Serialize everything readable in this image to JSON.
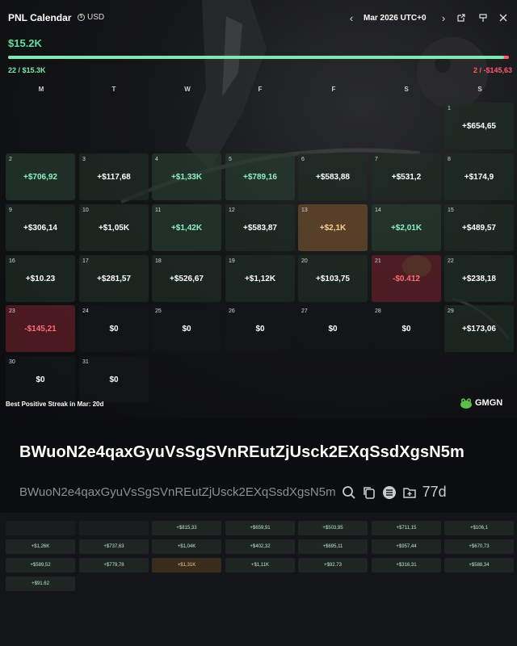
{
  "header": {
    "title": "PNL Calendar",
    "currency": "USD",
    "month": "Mar 2026 UTC+0"
  },
  "summary": {
    "total": "$15.2K",
    "wins": "22 / $15.3K",
    "losses_count": "2 /",
    "losses_amount": "-$145,63",
    "win_fraction": 0.99
  },
  "weekdays": [
    "M",
    "T",
    "W",
    "F",
    "F",
    "S",
    "S"
  ],
  "weekday_labels": {
    "m": "M",
    "t": "T",
    "w": "W",
    "th": "F",
    "f": "F",
    "s": "S",
    "su": "S"
  },
  "days": [
    {
      "d": "1",
      "v": "+$654,65"
    },
    {
      "d": "2",
      "v": "+$706,92"
    },
    {
      "d": "3",
      "v": "+$117,68"
    },
    {
      "d": "4",
      "v": "+$1,33K"
    },
    {
      "d": "5",
      "v": "+$789,16"
    },
    {
      "d": "6",
      "v": "+$583,88"
    },
    {
      "d": "7",
      "v": "+$531,2"
    },
    {
      "d": "8",
      "v": "+$174,9"
    },
    {
      "d": "9",
      "v": "+$306,14"
    },
    {
      "d": "10",
      "v": "+$1,05K"
    },
    {
      "d": "11",
      "v": "+$1,42K"
    },
    {
      "d": "12",
      "v": "+$583,87"
    },
    {
      "d": "13",
      "v": "+$2,1K"
    },
    {
      "d": "14",
      "v": "+$2,01K"
    },
    {
      "d": "15",
      "v": "+$489,57"
    },
    {
      "d": "16",
      "v": "+$10.23"
    },
    {
      "d": "17",
      "v": "+$281,57"
    },
    {
      "d": "18",
      "v": "+$526,67"
    },
    {
      "d": "19",
      "v": "+$1,12K"
    },
    {
      "d": "20",
      "v": "+$103,75"
    },
    {
      "d": "21",
      "v": "-$0.412"
    },
    {
      "d": "22",
      "v": "+$238,18"
    },
    {
      "d": "23",
      "v": "-$145,21"
    },
    {
      "d": "24",
      "v": "$0"
    },
    {
      "d": "25",
      "v": "$0"
    },
    {
      "d": "26",
      "v": "$0"
    },
    {
      "d": "27",
      "v": "$0"
    },
    {
      "d": "28",
      "v": "$0"
    },
    {
      "d": "29",
      "v": "+$173,06"
    },
    {
      "d": "30",
      "v": "$0"
    },
    {
      "d": "31",
      "v": "$0"
    }
  ],
  "footer": {
    "streak_label": "Best Positive Streak in Mar:",
    "streak_value": "20d",
    "brand": "GMGN"
  },
  "wallet": {
    "address": "BWuoN2e4qaxGyuVsSgSVnREutZjUsck2EXqSsdXgsN5m",
    "address_short": "BWuoN2e4qaxGyuVsSgSVnREutZjUsck2EXqSsdXgsN5m",
    "age": "77d"
  },
  "mini_calendar": [
    "+$815,33",
    "+$659,91",
    "+$503,95",
    "+$711,15",
    "+$106,1",
    "+$1,26K",
    "+$737,63",
    "+$1,04K",
    "+$402,32",
    "+$695,11",
    "+$957,44",
    "+$670,73",
    "+$589,52",
    "+$779,78",
    "+$1,31K",
    "+$1,11K",
    "+$92.73",
    "+$316,31",
    "+$588,34",
    "+$91.62"
  ],
  "colors": {
    "positive": "#7de8b0",
    "negative": "#ff5a6e",
    "gold": "#ffcf8f"
  }
}
